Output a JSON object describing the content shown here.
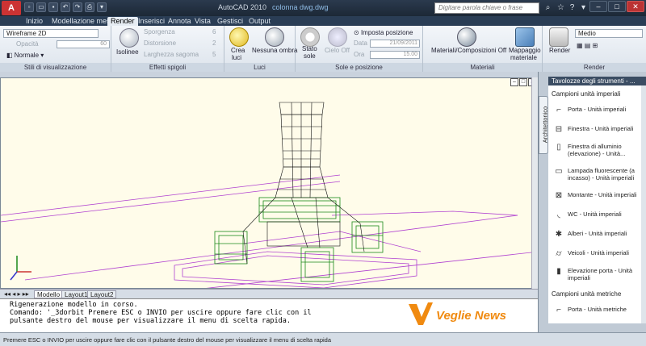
{
  "titlebar": {
    "app_title": "AutoCAD 2010",
    "doc_title": "colonna dwg.dwg",
    "search_placeholder": "Digitare parola chiave o frase",
    "app_button": "A"
  },
  "tabs": [
    "Inizio",
    "Modellazione mesh",
    "Render",
    "Inserisci",
    "Annota",
    "Vista",
    "Gestisci",
    "Output"
  ],
  "active_tab": "Render",
  "ribbon": {
    "stili": {
      "visual_style": "Wireframe 2D",
      "opacity_label": "Opacità",
      "opacity_value": "60",
      "normal": "Normale",
      "title": "Stili di visualizzazione"
    },
    "effetti": {
      "isolines": "Isolinee",
      "sporgenza": "Sporgenza",
      "sporgenza_val": "6",
      "distorsione": "Distorsione",
      "distorsione_val": "2",
      "larghezza": "Larghezza sagoma",
      "larghezza_val": "5",
      "title": "Effetti spigoli"
    },
    "luci": {
      "crea": "Crea",
      "luci": "luci",
      "nessuna": "Nessuna ombra",
      "title": "Luci"
    },
    "sole": {
      "stato": "Stato",
      "sole": "sole",
      "cielo": "Cielo Off",
      "imposta": "Imposta posizione",
      "data_label": "Data",
      "data_val": "21/09/2011",
      "ora_label": "Ora",
      "ora_val": "15.00",
      "title": "Sole e posizione"
    },
    "materiali": {
      "mat": "Materiali/Composizioni Off",
      "mapping": "Mappaggio",
      "materiale": "materiale",
      "title": "Materiali"
    },
    "render": {
      "render": "Render",
      "quality": "Medio",
      "title": "Render"
    }
  },
  "layout_tabs": [
    "Modello",
    "Layout1",
    "Layout2"
  ],
  "command": {
    "line1": "Rigenerazione modello in corso.",
    "line2": "Comando: '_3dorbit Premere ESC o INVIO per uscire oppure fare clic con il",
    "line3": "pulsante destro del mouse per visualizzare il menu di scelta rapida."
  },
  "status": "Premere ESC o INVIO per uscire oppure fare clic con il pulsante destro del mouse per visualizzare il menu di scelta rapida",
  "palette": {
    "title": "Tavolozze degli strumenti - ...",
    "vtab": "Architettonico",
    "section1": "Campioni unità imperiali",
    "items": [
      {
        "label": "Porta - Unità imperiali",
        "icon": "door-icon"
      },
      {
        "label": "Finestra - Unità imperiali",
        "icon": "window-icon"
      },
      {
        "label": "Finestra di alluminio (elevazione) - Unità...",
        "icon": "aluminum-window-icon"
      },
      {
        "label": "Lampada fluorescente (a incasso) - Unità imperiali",
        "icon": "fluorescent-lamp-icon"
      },
      {
        "label": "Montante - Unità imperiali",
        "icon": "mullion-icon"
      },
      {
        "label": "WC - Unità imperiali",
        "icon": "toilet-icon"
      },
      {
        "label": "Alberi - Unità imperiali",
        "icon": "tree-icon"
      },
      {
        "label": "Veicoli - Unità imperiali",
        "icon": "vehicle-icon"
      },
      {
        "label": "Elevazione porta - Unità imperiali",
        "icon": "door-elevation-icon"
      }
    ],
    "section2": "Campioni unità metriche",
    "metric_item": "Porta - Unità metriche"
  },
  "watermark": "Veglie News",
  "colors": {
    "accent": "#2a3d55",
    "wire_green": "#1a8a1a",
    "wire_magenta": "#b040d0",
    "canvas": "#fffcea"
  }
}
